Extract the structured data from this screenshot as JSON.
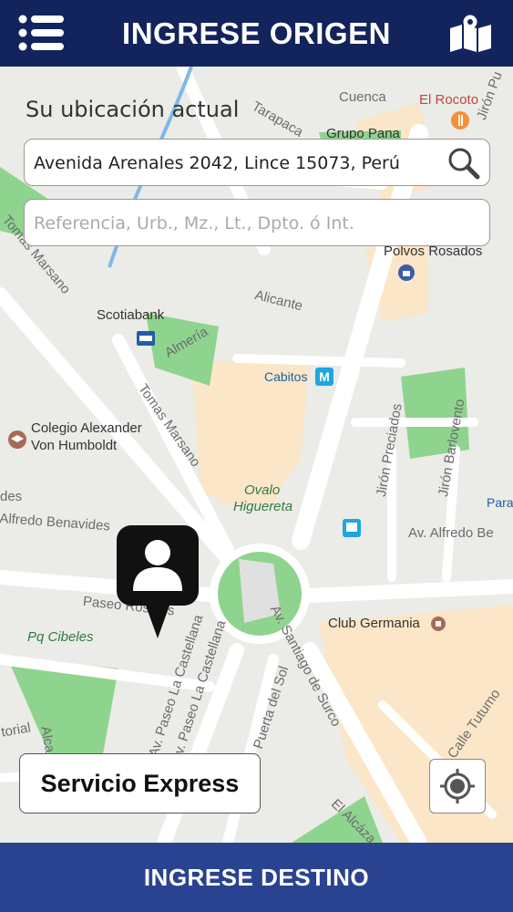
{
  "header": {
    "title": "INGRESE ORIGEN",
    "menu_icon": "hamburger-menu-icon",
    "map_icon": "folded-map-icon"
  },
  "colors": {
    "header_bg": "#13235b",
    "footer_bg": "#2a4390",
    "park": "#8fd48e",
    "building": "#fbe6c8",
    "road": "#ffffff"
  },
  "location": {
    "label": "Su ubicación actual",
    "address_value": "Avenida Arenales 2042, Lince 15073, Perú",
    "reference_placeholder": "Referencia, Urb., Mz., Lt., Dpto. ó Int.",
    "search_icon": "search-icon"
  },
  "map": {
    "labels": {
      "cuenca": "Cuenca",
      "el_rocoto": "El Rocoto",
      "grupo_pana": "Grupo Pana",
      "jiron_pu": "Jirón Pu",
      "tarapaca": "Tarapaca",
      "tomas_marsano_top": "Tomas Marsano",
      "alicante": "Alicante",
      "polvos_rosados": "Polvos Rosados",
      "scotiabank": "Scotiabank",
      "almeria": "Almería",
      "cabitos": "Cabitos",
      "tomas_marsano": "Tomas Marsano",
      "colegio_1": "Colegio Alexander",
      "colegio_2": "Von Humboldt",
      "jiron_preciados": "Jirón Preciados",
      "jiron_barlovento": "Jirón Barlovento",
      "ovalo_1": "Ovalo",
      "ovalo_2": "Higuereta",
      "alfredo_benavides_left": "Alfredo Benavides",
      "des": "des",
      "av_alfredo_be": "Av. Alfredo Be",
      "para": "Para",
      "paseo_rosales": "Paseo Rosales",
      "pq_cibeles": "Pq Cibeles",
      "club_germania": "Club Germania",
      "av_paseo_castellana_1": "Av. Paseo La Castellana",
      "av_paseo_castellana_2": "Av. Paseo La Castellana",
      "puerta_del_sol": "Puerta del Sol",
      "av_santiago_surco": "Av. Santiago de Surco",
      "calle_tutumo": "Calle Tutumo",
      "el_alcazar": "El Alcáza",
      "torial": "torial",
      "alca": "Alca"
    }
  },
  "buttons": {
    "express": "Servicio Express",
    "locate_icon": "gps-target-icon",
    "destination": "INGRESE DESTINO"
  }
}
